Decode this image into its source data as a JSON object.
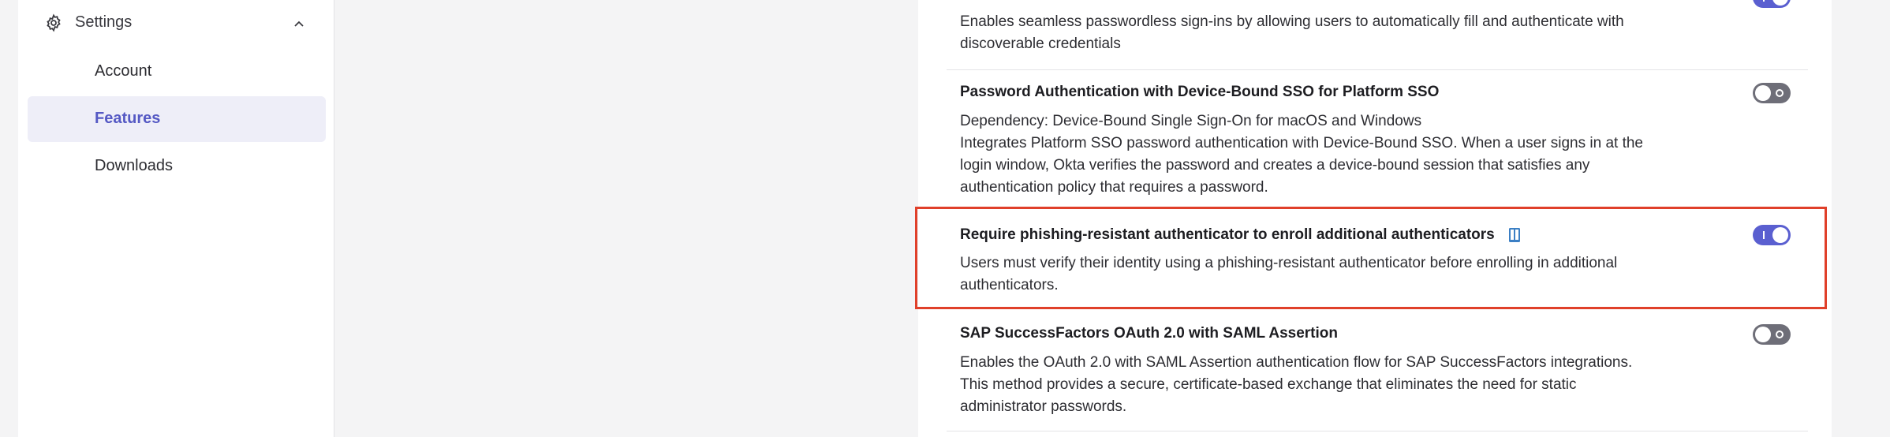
{
  "sidebar": {
    "settings_label": "Settings",
    "items": [
      {
        "label": "Account"
      },
      {
        "label": "Features"
      },
      {
        "label": "Downloads"
      }
    ]
  },
  "features": [
    {
      "desc_lines": [
        "Enables seamless passwordless sign-ins by allowing users to automatically fill and authenticate with",
        "discoverable credentials"
      ],
      "state": "on"
    },
    {
      "title": "Password Authentication with Device-Bound SSO for Platform SSO",
      "desc_lines": [
        "Dependency: Device-Bound Single Sign-On for macOS and Windows",
        "Integrates Platform SSO password authentication with Device-Bound SSO. When a user signs in at the",
        "login window, Okta verifies the password and creates a device-bound session that satisfies any",
        "authentication policy that requires a password."
      ],
      "state": "off"
    },
    {
      "title": "Require phishing-resistant authenticator to enroll additional authenticators",
      "desc_lines": [
        "Users must verify their identity using a phishing-resistant authenticator before enrolling in additional",
        "authenticators."
      ],
      "state": "on"
    },
    {
      "title": "SAP SuccessFactors OAuth 2.0 with SAML Assertion",
      "desc_lines": [
        "Enables the OAuth 2.0 with SAML Assertion authentication flow for SAP SuccessFactors integrations.",
        "This method provides a secure, certificate-based exchange that eliminates the need for static",
        "administrator passwords."
      ],
      "state": "off"
    }
  ],
  "colors": {
    "accent": "#5a5fd0",
    "toggle_off": "#6e6e78",
    "highlight": "#e0402a",
    "active_nav_bg": "#eeeef8"
  },
  "icons": [
    "gear-icon",
    "chevron-up-icon",
    "book-icon"
  ]
}
